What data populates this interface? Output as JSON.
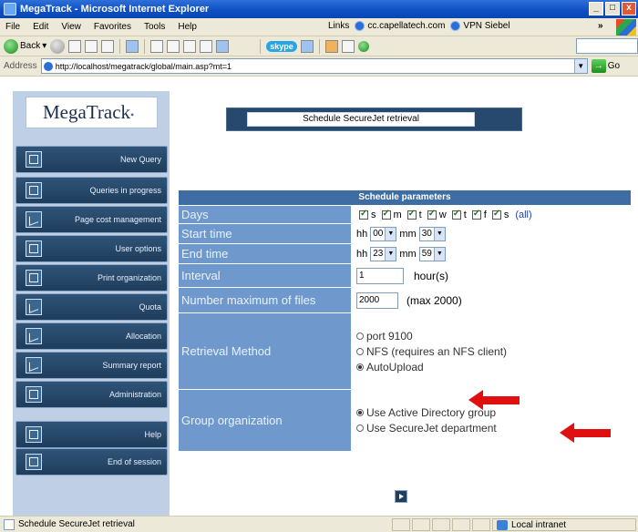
{
  "window": {
    "title": "MegaTrack - Microsoft Internet Explorer",
    "controls": [
      "_",
      "□",
      "x"
    ]
  },
  "menu": {
    "items": [
      "File",
      "Edit",
      "View",
      "Favorites",
      "Tools",
      "Help"
    ],
    "links_label": "Links",
    "links": [
      "cc.capellatech.com",
      "VPN Siebel"
    ]
  },
  "toolbar": {
    "back_label": "Back",
    "skype_label": "skype"
  },
  "address": {
    "label": "Address",
    "url": "http://localhost/megatrack/global/main.asp?mt=1",
    "go_label": "Go"
  },
  "app": {
    "logo": "MegaTrack",
    "page_title": "Schedule SecureJet retrieval"
  },
  "nav": {
    "items": [
      {
        "label": "New Query",
        "icon": "new-query-icon"
      },
      {
        "label": "Queries in progress",
        "icon": "queries-icon"
      },
      {
        "label": "Page cost management",
        "icon": "chart-icon"
      },
      {
        "label": "User options",
        "icon": "user-options-icon"
      },
      {
        "label": "Print organization",
        "icon": "print-org-icon"
      },
      {
        "label": "Quota",
        "icon": "quota-icon"
      },
      {
        "label": "Allocation",
        "icon": "allocation-icon"
      },
      {
        "label": "Summary report",
        "icon": "report-icon"
      },
      {
        "label": "Administration",
        "icon": "admin-icon"
      },
      {
        "label": "Help",
        "icon": "help-icon"
      },
      {
        "label": "End of session",
        "icon": "logout-icon"
      }
    ]
  },
  "params": {
    "header": "Schedule parameters",
    "days": {
      "label": "Days",
      "options": [
        "s",
        "m",
        "t",
        "w",
        "t",
        "f",
        "s"
      ],
      "all_link": "(all)"
    },
    "start_time": {
      "label": "Start time",
      "hh_label": "hh",
      "hh": "00",
      "mm_label": "mm",
      "mm": "30"
    },
    "end_time": {
      "label": "End time",
      "hh_label": "hh",
      "hh": "23",
      "mm_label": "mm",
      "mm": "59"
    },
    "interval": {
      "label": "Interval",
      "value": "1",
      "unit": "hour(s)"
    },
    "max_files": {
      "label": "Number maximum of files",
      "value": "2000",
      "note": "(max 2000)"
    },
    "retrieval": {
      "label": "Retrieval Method",
      "options": [
        "port 9100",
        "NFS (requires an NFS client)",
        "AutoUpload"
      ],
      "selected": "AutoUpload"
    },
    "group": {
      "label": "Group organization",
      "options": [
        "Use Active Directory group",
        "Use SecureJet department"
      ],
      "selected": "Use Active Directory group"
    }
  },
  "status": {
    "text": "Schedule SecureJet retrieval",
    "zone": "Local intranet"
  },
  "colors": {
    "accent_arrow": "#e01010",
    "label_bg": "#6f99cc",
    "header_bg": "#3e6da4",
    "nav_bg": "#1f3d5c"
  }
}
